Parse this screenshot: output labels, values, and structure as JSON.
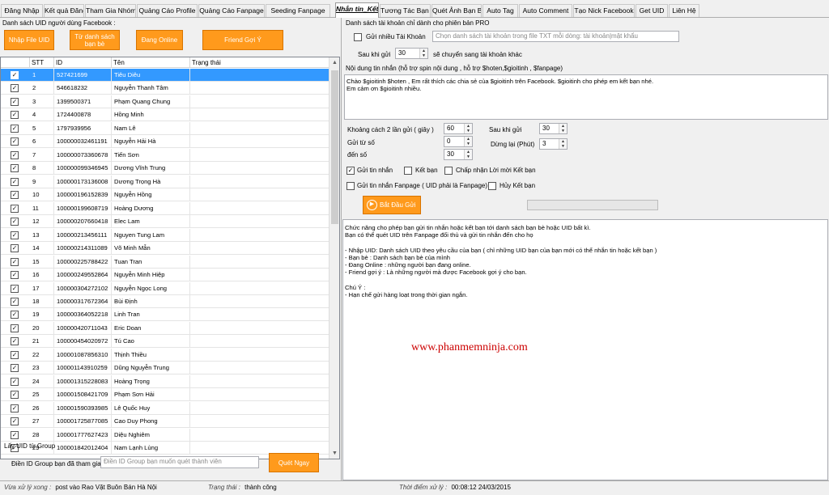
{
  "tabs": [
    {
      "label": "Đăng Nhập",
      "active": false
    },
    {
      "label": "Kết quả Đăng",
      "active": false
    },
    {
      "label": "Tham Gia Nhóm",
      "active": false
    },
    {
      "label": "Quảng Cáo Profile",
      "active": false
    },
    {
      "label": "Quảng Cáo Fanpage",
      "active": false
    },
    {
      "label": "Seeding Fanpage",
      "active": false
    },
    {
      "label": "Nhắn tin_Kết Bạn",
      "active": true
    },
    {
      "label": "Tương Tác Bạn Bè",
      "active": false
    },
    {
      "label": "Quét Ảnh Bạn Bè",
      "active": false
    },
    {
      "label": "Auto Tag",
      "active": false
    },
    {
      "label": "Auto Comment",
      "active": false
    },
    {
      "label": "Tạo Nick Facebook",
      "active": false
    },
    {
      "label": "Get UID",
      "active": false
    },
    {
      "label": "Liên Hệ",
      "active": false
    }
  ],
  "left": {
    "section_title": "Danh sách UID người dùng Facebook :",
    "buttons": {
      "import_uid": "Nhập File UID",
      "friends_list": "Từ danh sách bạn bè",
      "online": "Đang Online",
      "suggest": "Friend Gợi Ý"
    },
    "columns": [
      "STT",
      "ID",
      "Tên",
      "Trạng thái"
    ],
    "rows": [
      {
        "stt": "1",
        "id": "527421699",
        "name": "Tiêu Diêu"
      },
      {
        "stt": "2",
        "id": "546618232",
        "name": "Nguyễn Thanh Tâm"
      },
      {
        "stt": "3",
        "id": "1399500371",
        "name": "Phạm Quang Chung"
      },
      {
        "stt": "4",
        "id": "1724400878",
        "name": "Hồng Minh"
      },
      {
        "stt": "5",
        "id": "1797939956",
        "name": "Nam Lê"
      },
      {
        "stt": "6",
        "id": "100000032461191",
        "name": "Nguyễn Hải Hà"
      },
      {
        "stt": "7",
        "id": "100000073360678",
        "name": "Tiến Sơn"
      },
      {
        "stt": "8",
        "id": "100000099346945",
        "name": "Dương Vĩnh Trung"
      },
      {
        "stt": "9",
        "id": "100000173136008",
        "name": "Dương Trọng Hà"
      },
      {
        "stt": "10",
        "id": "100000196152839",
        "name": "Nguyễn Hồng"
      },
      {
        "stt": "11",
        "id": "100000199608719",
        "name": "Hoàng Dương"
      },
      {
        "stt": "12",
        "id": "100000207660418",
        "name": "Elec Lam"
      },
      {
        "stt": "13",
        "id": "100000213456111",
        "name": "Nguyen Tung Lam"
      },
      {
        "stt": "14",
        "id": "100000214311089",
        "name": "Võ Minh Mẫn"
      },
      {
        "stt": "15",
        "id": "100000225788422",
        "name": "Tuan Tran"
      },
      {
        "stt": "16",
        "id": "100000249552864",
        "name": "Nguyễn Minh Hiệp"
      },
      {
        "stt": "17",
        "id": "100000304272102",
        "name": "Nguyễn Ngọc Long"
      },
      {
        "stt": "18",
        "id": "100000317672364",
        "name": "Bùi Định"
      },
      {
        "stt": "19",
        "id": "100000364052218",
        "name": "Linh Tran"
      },
      {
        "stt": "20",
        "id": "100000420711043",
        "name": "Eric Doan"
      },
      {
        "stt": "21",
        "id": "100000454020972",
        "name": "Tú Cao"
      },
      {
        "stt": "22",
        "id": "100001087856310",
        "name": "Thịnh Thiều"
      },
      {
        "stt": "23",
        "id": "100001143910259",
        "name": "Dũng Nguyễn Trung"
      },
      {
        "stt": "24",
        "id": "100001315228083",
        "name": "Hoàng Trọng"
      },
      {
        "stt": "25",
        "id": "100001508421709",
        "name": "Phạm Sơn Hải"
      },
      {
        "stt": "26",
        "id": "100001590393985",
        "name": "Lê Quốc Huy"
      },
      {
        "stt": "27",
        "id": "100001725877085",
        "name": "Cao Duy Phong"
      },
      {
        "stt": "28",
        "id": "100001777627423",
        "name": "Diệu Nghiêm"
      },
      {
        "stt": "29",
        "id": "100001842012404",
        "name": "Nam Lạnh Lùng"
      }
    ],
    "group_section": "Lấy UID từ Group",
    "group_label": "Điền ID Group bạn đã tham gia",
    "group_placeholder": "Điền ID Group bạn muốn quét thành viên",
    "scan_button": "Quét Ngay"
  },
  "right": {
    "pro_title": "Danh sách tài khoản chỉ dành cho phiên bản PRO",
    "multi_account_label": "Gửi nhiều Tài Khoản",
    "multi_account_placeholder": "Chọn danh sách tài khoản trong file TXT mỗi dòng: tài khoản|mật khẩu",
    "after_send_label": "Sau khi gửi",
    "after_send_value": "30",
    "switch_label": "sẽ chuyển sang tài khoản khác",
    "message_title": "Nội dung tin nhắn  (hỗ trợ spin nội dung , hỗ trợ $hoten,$gioitinh , $fanpage)",
    "message_line1": "Chào $gioitinh $hoten , Em rất thích các chia sẻ của $gioitinh trên Facebook. $gioitinh cho phép em kết bạn nhé.",
    "message_line2": "Em cảm ơn $gioitinh nhiều.",
    "interval_label": "Khoảng cách 2 lần gửi ( giây )",
    "interval_value": "60",
    "from_label": "Gửi từ số",
    "from_value": "0",
    "to_label": "đến số",
    "to_value": "30",
    "after_send2_label": "Sau khi gửi",
    "after_send2_value": "30",
    "pause_label": "Dừng lại (Phút)",
    "pause_value": "3",
    "options": {
      "send_message": "Gửi tin nhắn",
      "add_friend": "Kết bạn",
      "accept_invites": "Chấp nhận Lời mời Kết bạn",
      "fanpage_message": "Gửi tin nhắn Fanpage ( UID phải là Fanpage)",
      "unfriend": "Hủy Kết bạn"
    },
    "start_button": "Bắt Đầu Gửi",
    "help_lines": [
      "Chức năng cho phép bạn gửi tin nhắn hoặc kết bạn tới danh sách bạn bè hoặc UID bất kì.",
      "Bạn có thể quét UID trên Fanpage đối thủ và gửi tin nhắn đến cho họ",
      "",
      "- Nhập UID: Danh sách UID theo yêu cầu của bạn ( chỉ những UID bạn của bạn mới có thể nhắn tin hoặc kết bạn )",
      "- Bạn bè : Danh sách bạn bè của mình",
      "- Đang Online : những người bạn đang online.",
      "- Friend gợi ý : Là những người mà được Facebook gợi ý cho bạn.",
      "",
      "Chú Ý :",
      "- Hạn chế gửi hàng loạt trong thời gian ngắn."
    ],
    "watermark": "www.phanmemninja.com"
  },
  "status": {
    "processed_label": "Vừa xử lý xong :",
    "processed_value": "post vào Rao Vặt Buôn Bán Hà Nội",
    "state_label": "Trạng thái :",
    "state_value": "thành công",
    "time_label": "Thời điểm xử lý :",
    "time_value": "00:08:12 24/03/2015"
  }
}
